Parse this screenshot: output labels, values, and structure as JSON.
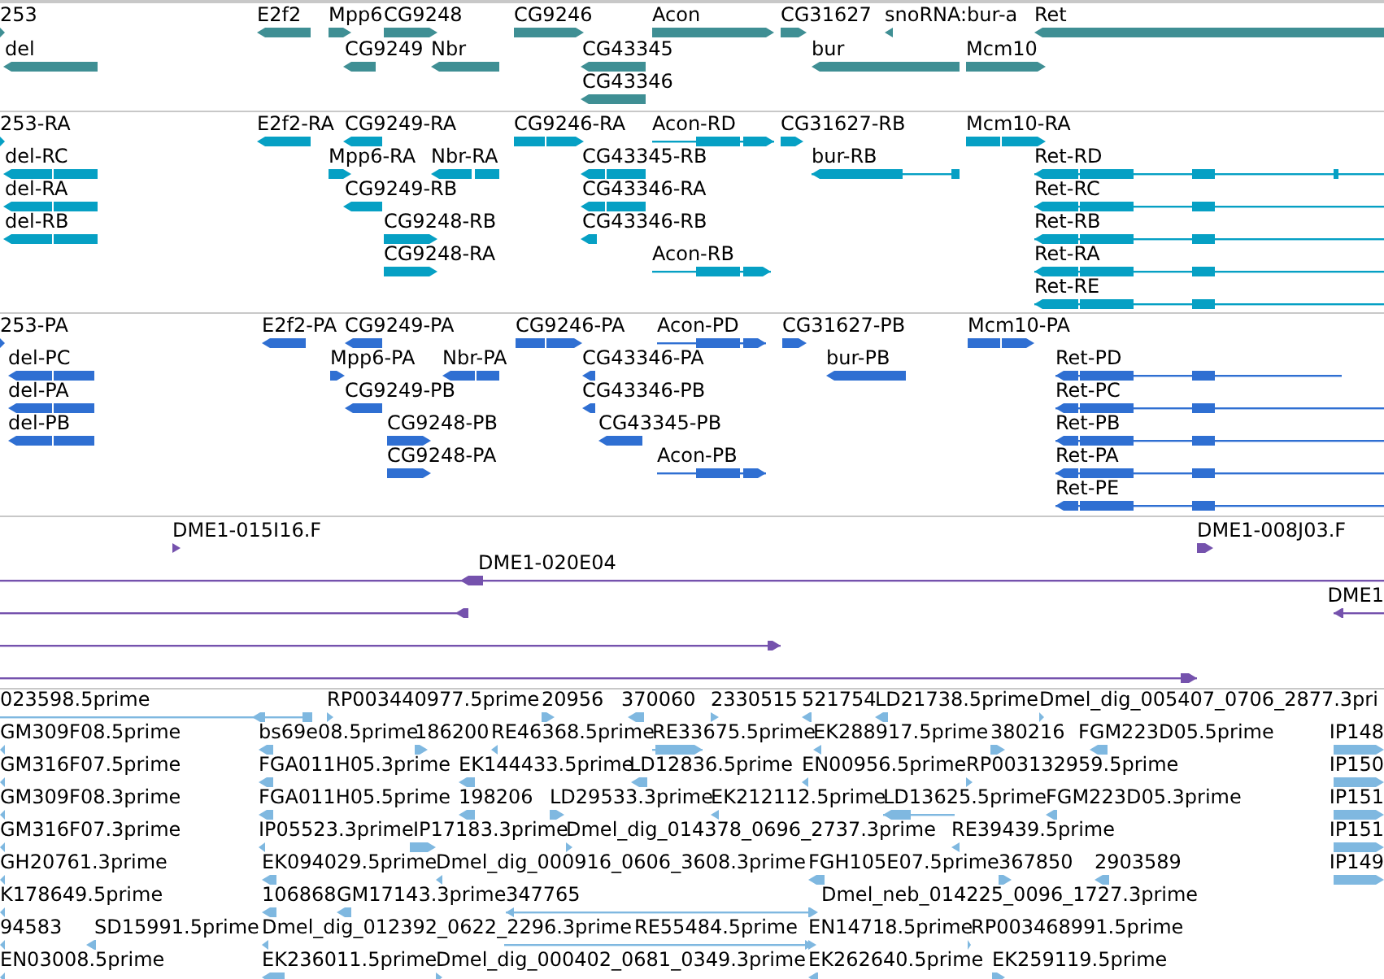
{
  "tracks": [
    {
      "kind": "gene",
      "features": [
        {
          "label": "253",
          "reverse": false
        },
        {
          "label": "E2f2",
          "reverse": true
        },
        {
          "label": "Mpp6",
          "reverse": false
        },
        {
          "label": "CG9248",
          "reverse": false
        },
        {
          "label": "CG9246",
          "reverse": false
        },
        {
          "label": "Acon",
          "reverse": false
        },
        {
          "label": "CG31627",
          "reverse": false
        },
        {
          "label": "snoRNA:bur-a",
          "reverse": true
        },
        {
          "label": "Ret",
          "reverse": true
        },
        {
          "label": "del",
          "reverse": true
        },
        {
          "label": "CG9249",
          "reverse": true
        },
        {
          "label": "Nbr",
          "reverse": true
        },
        {
          "label": "CG43345",
          "reverse": true
        },
        {
          "label": "bur",
          "reverse": true
        },
        {
          "label": "Mcm10",
          "reverse": false
        },
        {
          "label": "CG43346",
          "reverse": true
        }
      ]
    },
    {
      "kind": "transcript",
      "features": [
        {
          "label": "253-RA",
          "reverse": false
        },
        {
          "label": "E2f2-RA",
          "reverse": true
        },
        {
          "label": "CG9249-RA",
          "reverse": true
        },
        {
          "label": "CG9246-RA",
          "reverse": false
        },
        {
          "label": "Acon-RD",
          "reverse": false
        },
        {
          "label": "CG31627-RB",
          "reverse": false
        },
        {
          "label": "Mcm10-RA",
          "reverse": false
        },
        {
          "label": "del-RC",
          "reverse": true
        },
        {
          "label": "Mpp6-RA",
          "reverse": false
        },
        {
          "label": "Nbr-RA",
          "reverse": true
        },
        {
          "label": "CG43345-RB",
          "reverse": true
        },
        {
          "label": "bur-RB",
          "reverse": true
        },
        {
          "label": "Ret-RD",
          "reverse": true
        },
        {
          "label": "del-RA",
          "reverse": true
        },
        {
          "label": "CG9249-RB",
          "reverse": true
        },
        {
          "label": "CG43346-RA",
          "reverse": true
        },
        {
          "label": "Ret-RC",
          "reverse": true
        },
        {
          "label": "del-RB",
          "reverse": true
        },
        {
          "label": "CG9248-RB",
          "reverse": false
        },
        {
          "label": "CG43346-RB",
          "reverse": true
        },
        {
          "label": "Ret-RB",
          "reverse": true
        },
        {
          "label": "CG9248-RA",
          "reverse": false
        },
        {
          "label": "Acon-RB",
          "reverse": false
        },
        {
          "label": "Ret-RA",
          "reverse": true
        },
        {
          "label": "Ret-RE",
          "reverse": true
        }
      ]
    },
    {
      "kind": "protein",
      "features": [
        {
          "label": "253-PA",
          "reverse": false
        },
        {
          "label": "E2f2-PA",
          "reverse": true
        },
        {
          "label": "CG9249-PA",
          "reverse": true
        },
        {
          "label": "CG9246-PA",
          "reverse": false
        },
        {
          "label": "Acon-PD",
          "reverse": false
        },
        {
          "label": "CG31627-PB",
          "reverse": false
        },
        {
          "label": "Mcm10-PA",
          "reverse": false
        },
        {
          "label": "del-PC",
          "reverse": true
        },
        {
          "label": "Mpp6-PA",
          "reverse": false
        },
        {
          "label": "Nbr-PA",
          "reverse": true
        },
        {
          "label": "CG43346-PA",
          "reverse": true
        },
        {
          "label": "bur-PB",
          "reverse": true
        },
        {
          "label": "Ret-PD",
          "reverse": true
        },
        {
          "label": "del-PA",
          "reverse": true
        },
        {
          "label": "CG9249-PB",
          "reverse": true
        },
        {
          "label": "CG43346-PB",
          "reverse": true
        },
        {
          "label": "Ret-PC",
          "reverse": true
        },
        {
          "label": "del-PB",
          "reverse": true
        },
        {
          "label": "CG9248-PB",
          "reverse": false
        },
        {
          "label": "CG43345-PB",
          "reverse": true
        },
        {
          "label": "Ret-PB",
          "reverse": true
        },
        {
          "label": "CG9248-PA",
          "reverse": false
        },
        {
          "label": "Acon-PB",
          "reverse": false
        },
        {
          "label": "Ret-PA",
          "reverse": true
        },
        {
          "label": "Ret-PE",
          "reverse": true
        }
      ]
    },
    {
      "kind": "clone",
      "features": [
        {
          "label": "DME1-015I16.F",
          "reverse": false
        },
        {
          "label": "DME1-008J03.F",
          "reverse": false
        },
        {
          "label": "DME1-020E04",
          "reverse": true
        },
        {
          "reverse": true
        },
        {
          "label": "DME1",
          "reverse": true
        },
        {
          "reverse": false
        },
        {
          "reverse": false
        }
      ]
    },
    {
      "kind": "est",
      "features": [
        {
          "label": "023598.5prime",
          "reverse": true
        },
        {
          "label": "RP003440977.5prime",
          "reverse": false
        },
        {
          "label": "20956",
          "reverse": false
        },
        {
          "label": "370060",
          "reverse": true
        },
        {
          "label": "2330515",
          "reverse": false
        },
        {
          "label": "521754",
          "reverse": true
        },
        {
          "label": "LD21738.5prime",
          "reverse": true
        },
        {
          "label": "Dmel_dig_005407_0706_2877.3pri",
          "reverse": false
        },
        {
          "label": "GM309F08.5prime",
          "reverse": true
        },
        {
          "label": "bs69e08.5prime",
          "reverse": true
        },
        {
          "label": "186200",
          "reverse": false
        },
        {
          "label": "RE46368.5prime",
          "reverse": true
        },
        {
          "label": "RE33675.5prime",
          "reverse": false
        },
        {
          "label": "EK288917.5prime",
          "reverse": true
        },
        {
          "label": "380216",
          "reverse": false
        },
        {
          "label": "FGM223D05.5prime",
          "reverse": true
        },
        {
          "label": "IP148",
          "reverse": false
        },
        {
          "label": "GM316F07.5prime",
          "reverse": true
        },
        {
          "label": "FGA011H05.3prime",
          "reverse": true
        },
        {
          "label": "EK144433.5prime",
          "reverse": true
        },
        {
          "label": "LD12836.5prime",
          "reverse": true
        },
        {
          "label": "EN00956.5prime",
          "reverse": true
        },
        {
          "label": "RP003132959.5prime",
          "reverse": false
        },
        {
          "label": "IP150",
          "reverse": false
        },
        {
          "label": "GM309F08.3prime",
          "reverse": true
        },
        {
          "label": "FGA011H05.5prime",
          "reverse": true
        },
        {
          "label": "198206",
          "reverse": true
        },
        {
          "label": "LD29533.3prime",
          "reverse": false
        },
        {
          "label": "EK212112.5prime",
          "reverse": true
        },
        {
          "label": "LD13625.5prime",
          "reverse": true
        },
        {
          "label": "FGM223D05.3prime",
          "reverse": true
        },
        {
          "label": "IP151",
          "reverse": false
        },
        {
          "label": "GM316F07.3prime",
          "reverse": true
        },
        {
          "label": "IP05523.3prime",
          "reverse": true
        },
        {
          "label": "IP17183.3prime",
          "reverse": false
        },
        {
          "label": "Dmel_dig_014378_0696_2737.3prime",
          "reverse": false
        },
        {
          "label": "RE39439.5prime",
          "reverse": true
        },
        {
          "label": "IP151",
          "reverse": false
        },
        {
          "label": "GH20761.3prime",
          "reverse": true
        },
        {
          "label": "EK094029.5prime",
          "reverse": true
        },
        {
          "label": "Dmel_dig_000916_0606_3608.3prime",
          "reverse": true
        },
        {
          "label": "FGH105E07.5prime",
          "reverse": true
        },
        {
          "label": "367850",
          "reverse": false
        },
        {
          "label": "2903589",
          "reverse": true
        },
        {
          "label": "IP149",
          "reverse": false
        },
        {
          "label": "K178649.5prime",
          "reverse": true
        },
        {
          "label": "106868",
          "reverse": true
        },
        {
          "label": "GM17143.3prime",
          "reverse": true
        },
        {
          "label": "347765",
          "reverse": true
        },
        {
          "label": "Dmel_neb_014225_0096_1727.3prime",
          "reverse": false
        },
        {
          "label": "94583",
          "reverse": true
        },
        {
          "label": "SD15991.5prime",
          "reverse": true
        },
        {
          "label": "Dmel_dig_012392_0622_2296.3prime",
          "reverse": true
        },
        {
          "label": "RE55484.5prime",
          "reverse": false
        },
        {
          "label": "EN14718.5prime",
          "reverse": false
        },
        {
          "label": "RP003468991.5prime",
          "reverse": false
        },
        {
          "label": "EN03008.5prime",
          "reverse": true
        },
        {
          "label": "EK236011.5prime",
          "reverse": true
        },
        {
          "label": "Dmel_dig_000402_0681_0349.3prime",
          "reverse": false
        },
        {
          "label": "EK262640.5prime",
          "reverse": true
        },
        {
          "label": "EK259119.5prime",
          "reverse": false
        }
      ]
    }
  ]
}
